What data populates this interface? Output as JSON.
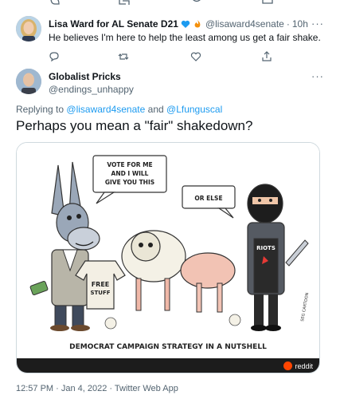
{
  "reply_tweet": {
    "display_name": "Lisa Ward for AL Senate D21",
    "handle": "@lisaward4senate",
    "time": "10h",
    "text": "He believes I'm here to help the least among us get a fair shake."
  },
  "main_tweet": {
    "display_name": "Globalist Pricks",
    "handle": "@endings_unhappy",
    "replying_prefix": "Replying to",
    "replying_user1": "@lisaward4senate",
    "replying_and": "and",
    "replying_user2": "@Lfunguscal",
    "text": "Perhaps you mean a \"fair\" shakedown?",
    "timestamp": "12:57 PM · Jan 4, 2022 · Twitter Web App"
  },
  "cartoon": {
    "donkey_bubble": [
      "VOTE FOR ME",
      "AND I WILL",
      "GIVE YOU THIS"
    ],
    "thug_bubble": "OR ELSE",
    "sweater_label": [
      "FREE",
      "STUFF"
    ],
    "shirt_label": "RIOTS",
    "artist_signature": "SEG CARTOON",
    "caption": "DEMOCRAT CAMPAIGN STRATEGY IN A NUTSHELL"
  },
  "media_source": "reddit",
  "more_glyph": "···",
  "colors": {
    "link": "#1d9bf0",
    "secondary_text": "#536471",
    "reddit": "#ff4500",
    "verified": "#1d9bf0"
  }
}
